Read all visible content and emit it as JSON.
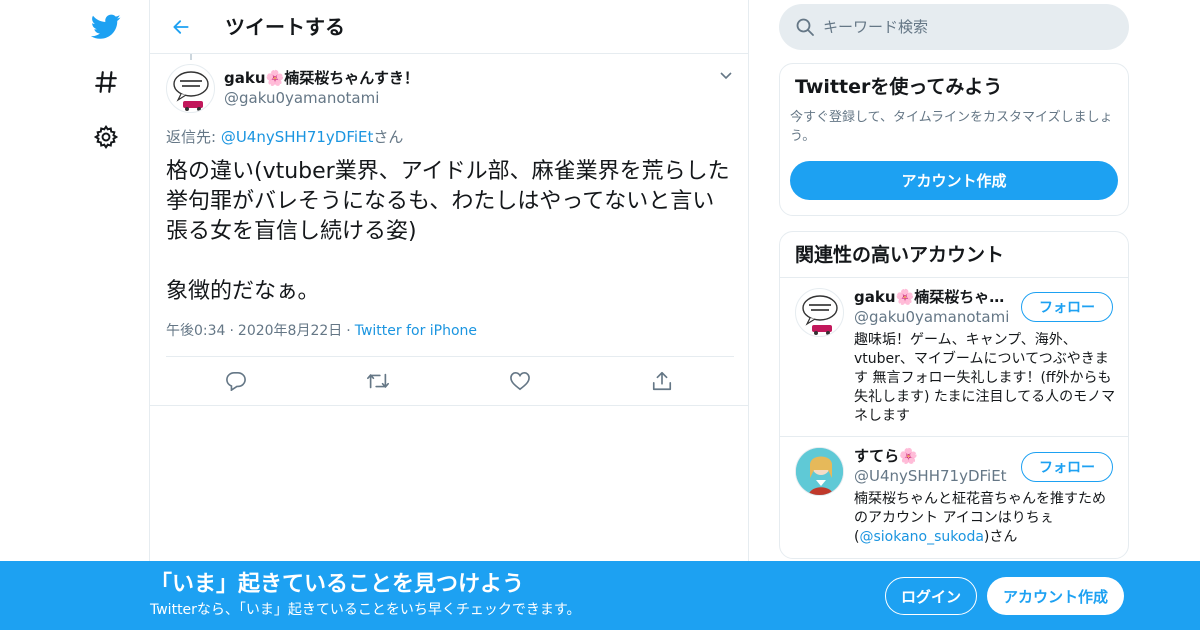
{
  "nav": {
    "items": [
      {
        "icon": "twitter-bird-icon"
      },
      {
        "icon": "hashtag-icon"
      },
      {
        "icon": "gear-icon"
      }
    ]
  },
  "header": {
    "title": "ツイートする"
  },
  "tweet": {
    "author_name": "gaku🌸楠栞桜ちゃんすき！",
    "author_handle": "@gaku0yamanotami",
    "reply_prefix": "返信先: ",
    "reply_to": "@U4nySHH71yDFiEt",
    "reply_suffix": "さん",
    "text": "格の違い(vtuber業界、アイドル部、麻雀業界を荒らした挙句罪がバレそうになるも、わたしはやってないと言い張る女を盲信し続ける姿)\n\n象徴的だなぁ。",
    "time": "午後0:34",
    "date": "2020年8月22日",
    "source": "Twitter for iPhone"
  },
  "search": {
    "placeholder": "キーワード検索"
  },
  "signup_card": {
    "title": "Twitterを使ってみよう",
    "desc": "今すぐ登録して、タイムラインをカスタマイズしましょう。",
    "button": "アカウント作成"
  },
  "related": {
    "title": "関連性の高いアカウント",
    "accounts": [
      {
        "name": "gaku🌸楠栞桜ちゃん...",
        "handle": "@gaku0yamanotami",
        "follow": "フォロー",
        "bio": "趣味垢！ゲーム、キャンプ、海外、vtuber、マイブームについてつぶやきます 無言フォロー失礼します！(ff外からも失礼します) たまに注目してる人のモノマネします"
      },
      {
        "name": "すてら🌸",
        "handle": "@U4nySHH71yDFiEt",
        "follow": "フォロー",
        "bio_prefix": "楠栞桜ちゃんと柾花音ちゃんを推すためのアカウント アイコンはりちぇ(",
        "bio_link": "@siokano_sukoda",
        "bio_suffix": ")さん"
      }
    ]
  },
  "banner": {
    "title": "「いま」起きていることを見つけよう",
    "subtitle": "Twitterなら、「いま」起きていることをいち早くチェックできます。",
    "login": "ログイン",
    "signup": "アカウント作成"
  },
  "colors": {
    "brand": "#1da1f2",
    "link": "#1b95e0",
    "muted": "#657786",
    "border": "#e6ecf0"
  }
}
